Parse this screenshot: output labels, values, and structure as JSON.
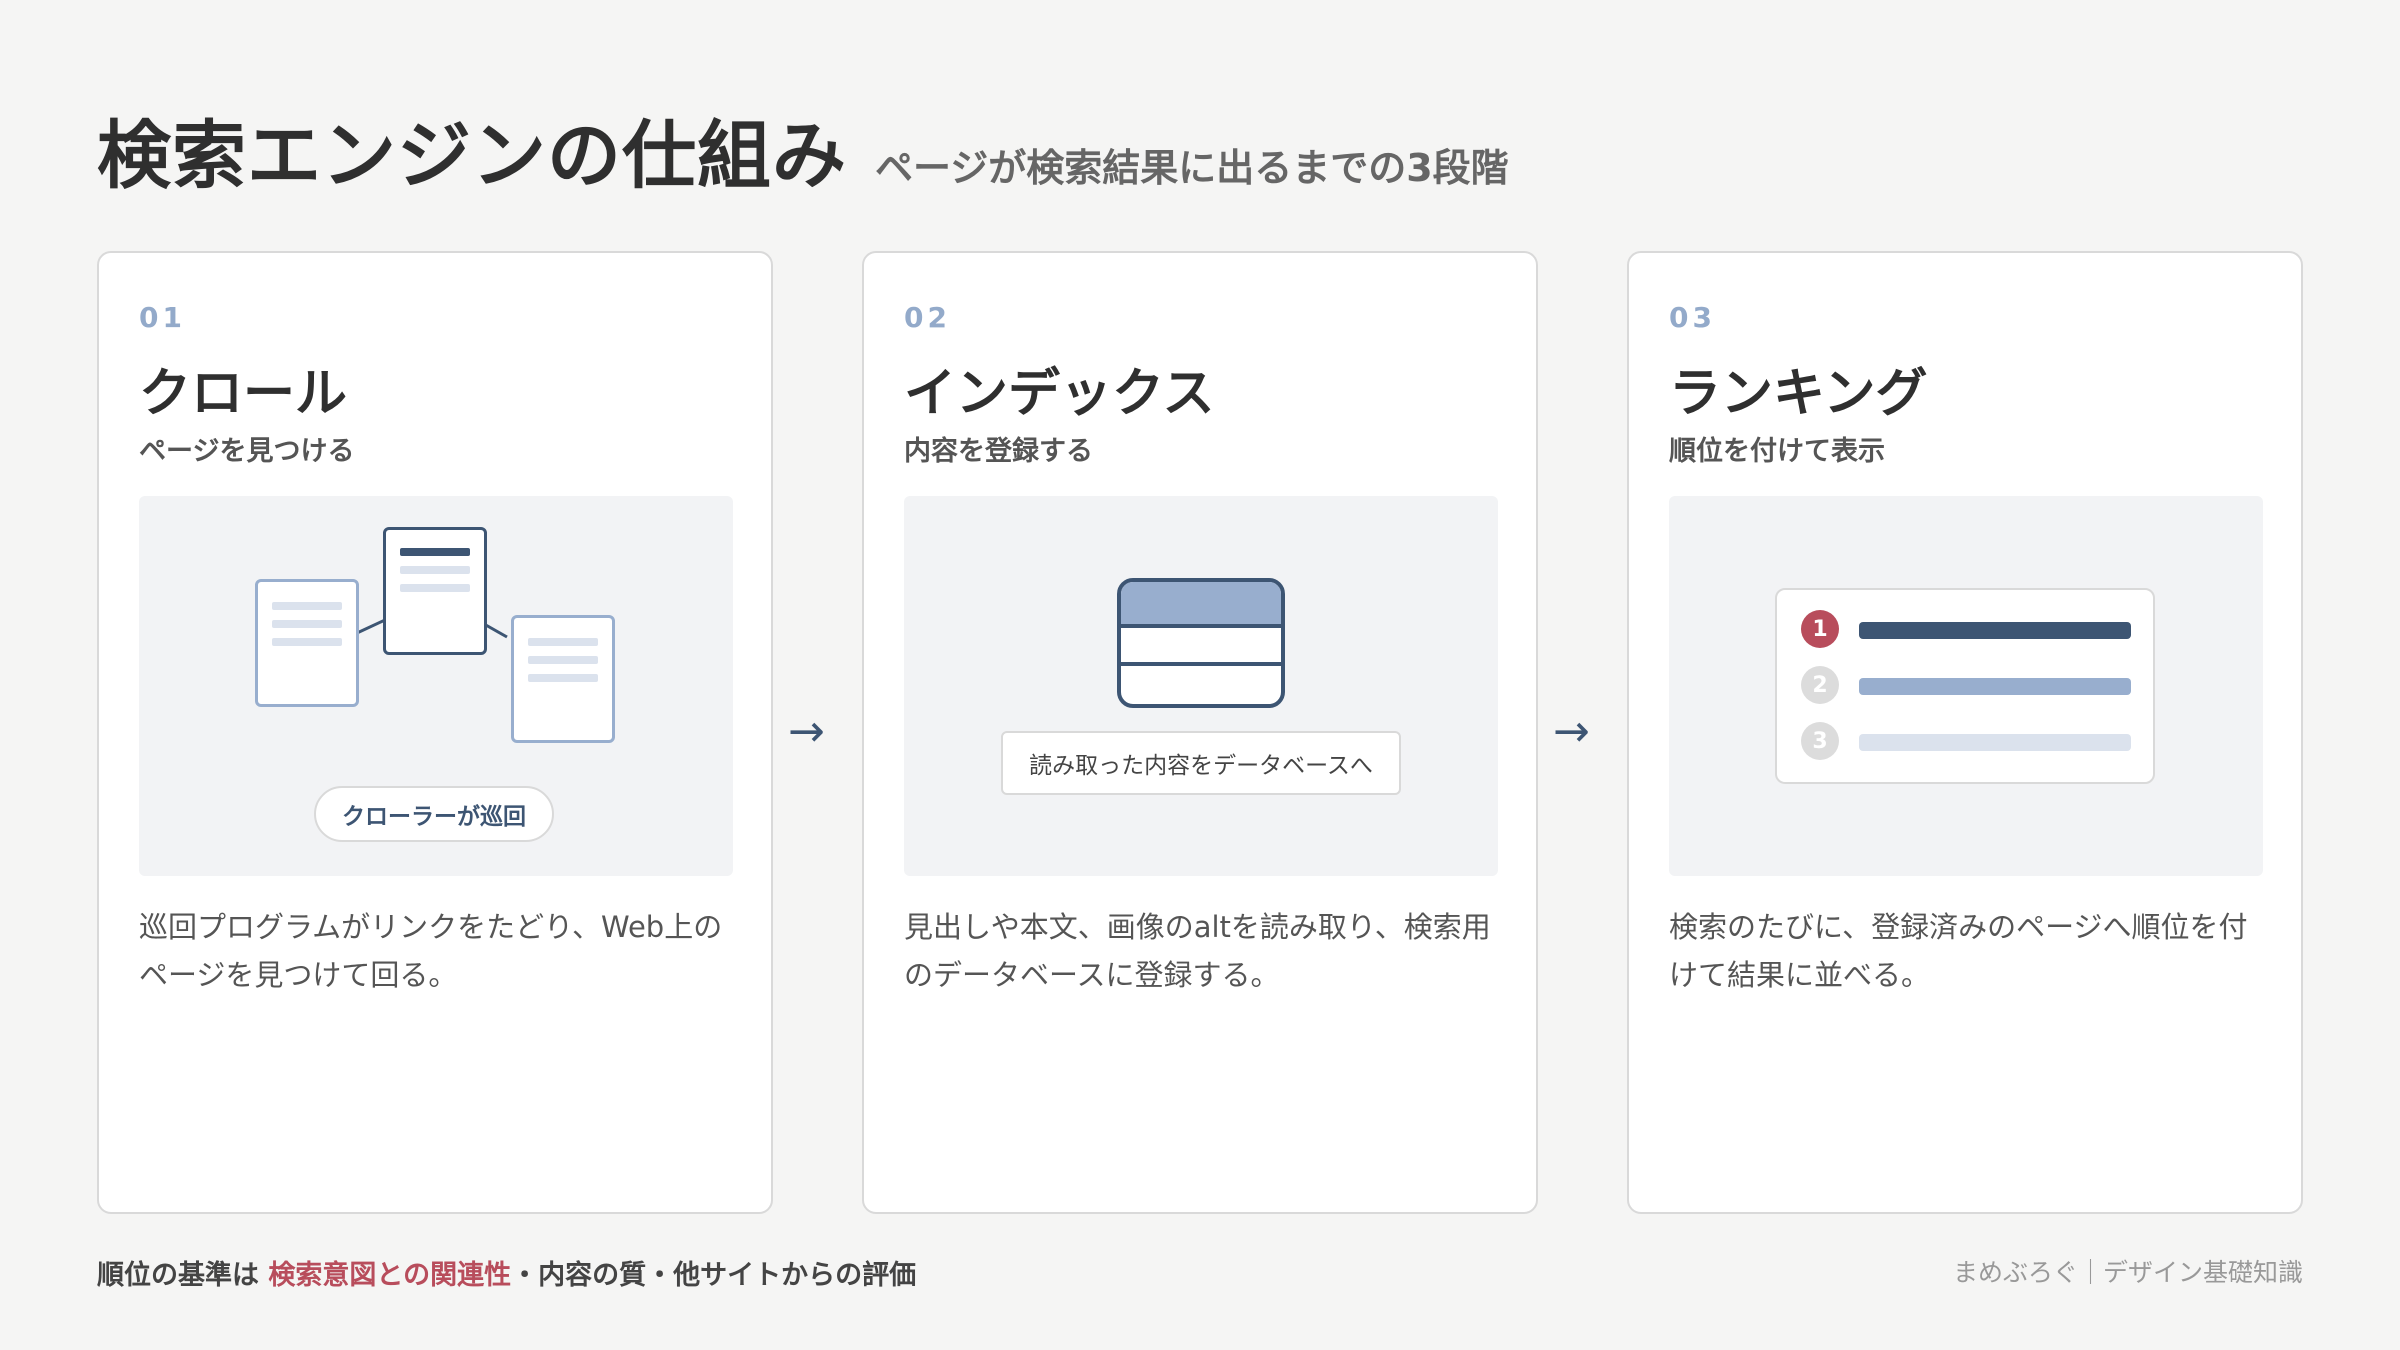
{
  "header": {
    "title": "検索エンジンの仕組み",
    "subtitle": "ページが検索結果に出るまでの3段階"
  },
  "steps": [
    {
      "number": "01",
      "title": "クロール",
      "subtitle": "ページを見つける",
      "illustration_label": "クローラーが巡回",
      "description": "巡回プログラムがリンクをたどり、Web上のページを見つけて回る。"
    },
    {
      "number": "02",
      "title": "インデックス",
      "subtitle": "内容を登録する",
      "illustration_label": "読み取った内容をデータベースへ",
      "description": "見出しや本文、画像のaltを読み取り、検索用のデータベースに登録する。"
    },
    {
      "number": "03",
      "title": "ランキング",
      "subtitle": "順位を付けて表示",
      "ranks": [
        "1",
        "2",
        "3"
      ],
      "description": "検索のたびに、登録済みのページへ順位を付けて結果に並べる。"
    }
  ],
  "arrow": "→",
  "footer": {
    "prefix": "順位の基準は",
    "highlight": "検索意図との関連性",
    "suffix": "・内容の質・他サイトからの評価",
    "credit": "まめぶろぐ｜デザイン基礎知識"
  },
  "colors": {
    "accent_dark": "#3d5573",
    "accent_mid": "#98aece",
    "accent_light": "#dbe2ed",
    "highlight": "#b84d5c",
    "step_number": "#93aaca"
  }
}
